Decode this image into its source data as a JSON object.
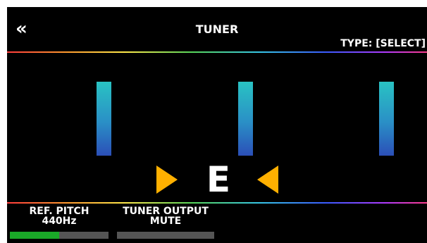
{
  "header": {
    "back_label": "«",
    "title": "TUNER",
    "type_label": "TYPE: [SELECT]"
  },
  "tuner": {
    "note": "E",
    "indicator_left_color": "#ffb000",
    "indicator_right_color": "#ffb000",
    "bar_color_top": "#29c3c3",
    "bar_color_bottom": "#2b4fb8"
  },
  "params": [
    {
      "label": "REF. PITCH",
      "value": "440Hz",
      "level": 0.5
    },
    {
      "label": "TUNER OUTPUT",
      "value": "MUTE",
      "level": 0.0
    }
  ],
  "colors": {
    "background": "#000000",
    "text": "#ffffff",
    "level_fill": "#1aa828",
    "level_track": "#555555"
  }
}
